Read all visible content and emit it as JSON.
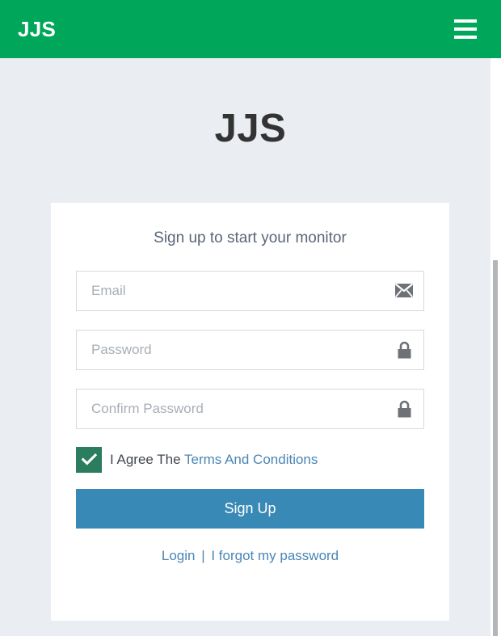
{
  "navbar": {
    "brand": "JJS",
    "menu_icon": "hamburger-menu-icon",
    "background_color": "#00a65a"
  },
  "page": {
    "title": "JJS",
    "background_color": "#eaedf1"
  },
  "card": {
    "heading": "Sign up to start your monitor",
    "background_color": "#ffffff"
  },
  "form": {
    "fields": [
      {
        "name": "email",
        "placeholder": "Email",
        "value": "",
        "type": "email",
        "icon": "envelope-icon"
      },
      {
        "name": "password",
        "placeholder": "Password",
        "value": "",
        "type": "password",
        "icon": "lock-icon"
      },
      {
        "name": "confirm-password",
        "placeholder": "Confirm Password",
        "value": "",
        "type": "password",
        "icon": "lock-icon"
      }
    ],
    "agreement": {
      "checked": true,
      "checkbox_color": "#2a7d5f",
      "check_icon": "checkmark-icon",
      "text": "I Agree The",
      "link_text": "Terms And Conditions"
    },
    "submit_label": "Sign Up",
    "submit_color": "#3889b5"
  },
  "footer": {
    "login_label": "Login",
    "separator": "|",
    "forgot_label": "I forgot my password",
    "link_color": "#4a86b4"
  },
  "scrollbar": {
    "thumb_color": "#b2b6ba"
  }
}
